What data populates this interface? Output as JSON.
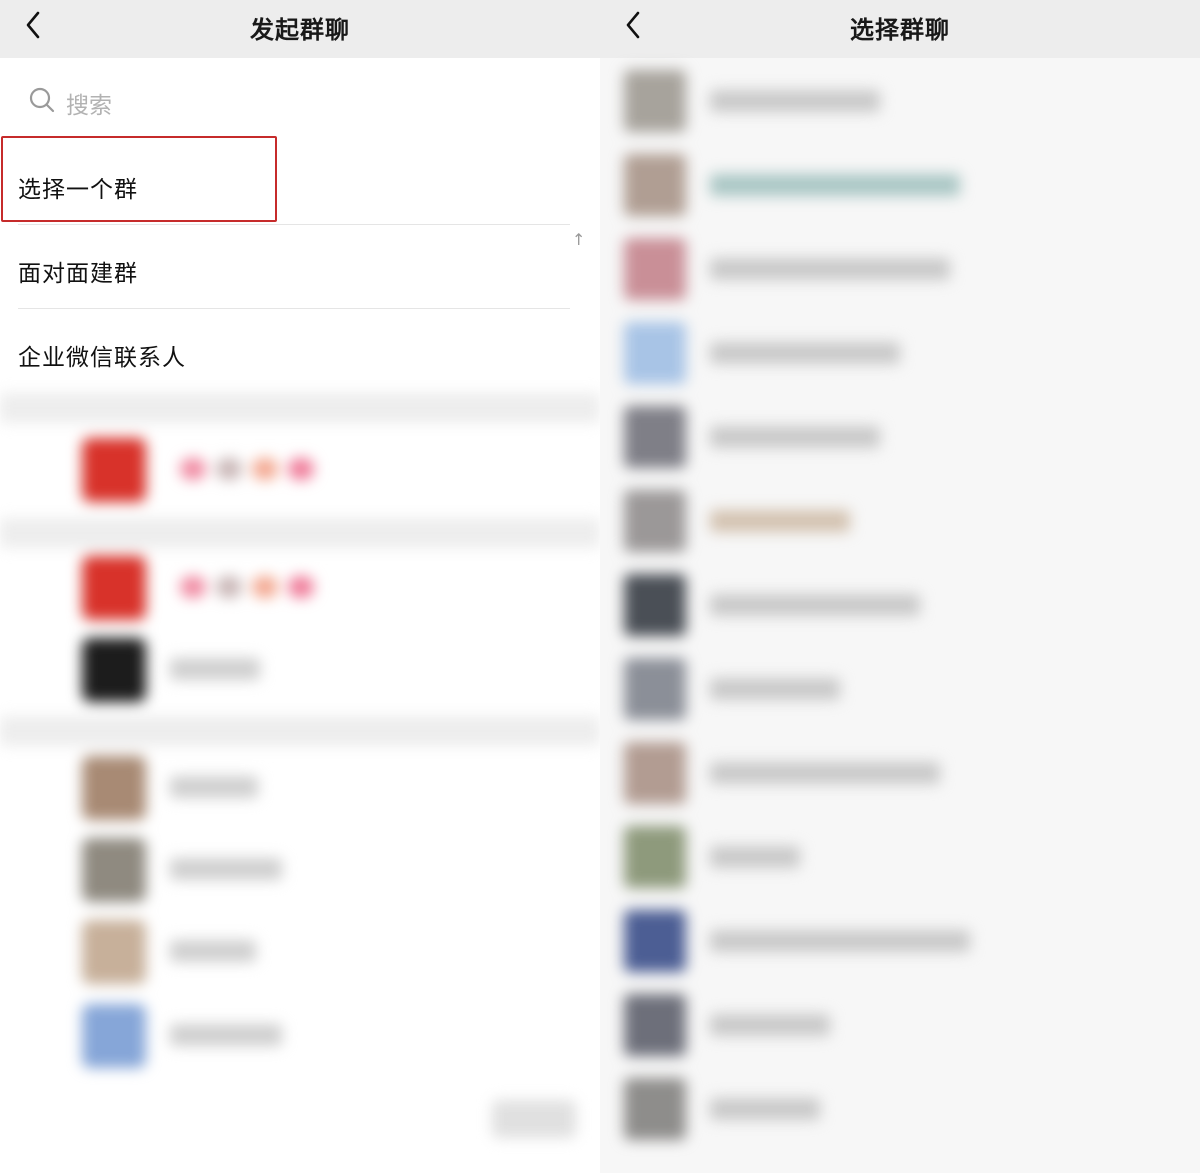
{
  "left": {
    "title": "发起群聊",
    "search_placeholder": "搜索",
    "menu": [
      {
        "label": "选择一个群"
      },
      {
        "label": "面对面建群"
      },
      {
        "label": "企业微信联系人"
      }
    ],
    "index_arrow": "↑"
  },
  "right": {
    "title": "选择群聊"
  },
  "colors": {
    "highlight": "#c62b2b",
    "nav_bg": "#ededed"
  },
  "icons": {
    "back": "chevron-left-icon",
    "search": "search-icon"
  }
}
